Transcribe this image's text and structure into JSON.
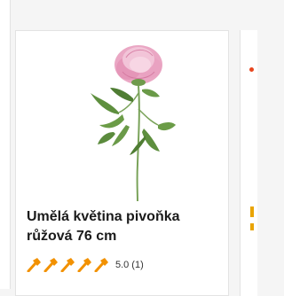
{
  "product": {
    "title_line1": "Umělá květina pivoňka",
    "title_line2": "růžová 76 cm",
    "image_icon": "pink-peony-flower",
    "rating": {
      "value": "5.0",
      "count": "(1)",
      "stars": 5,
      "icon": "hammer-icon",
      "color": "#f29100"
    }
  },
  "colors": {
    "accent": "#f29100",
    "border": "#e3e3e3",
    "background": "#f5f5f5",
    "card": "#ffffff"
  }
}
